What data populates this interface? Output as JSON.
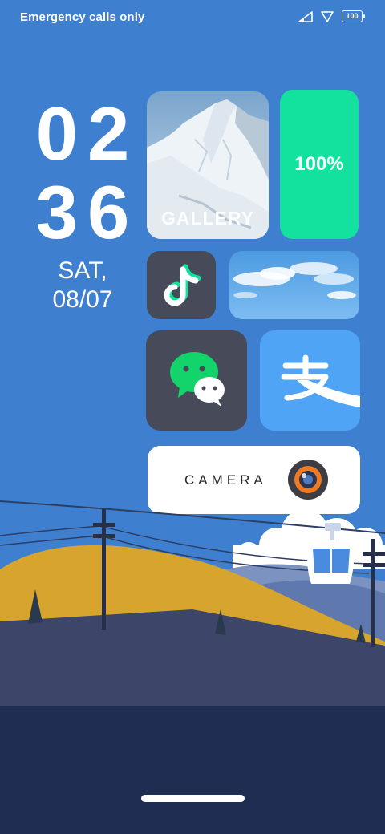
{
  "status_bar": {
    "carrier_text": "Emergency calls only",
    "battery_level": "100"
  },
  "clock": {
    "hours": "02",
    "minutes": "36",
    "day": "SAT,",
    "date": "08/07"
  },
  "widgets": {
    "gallery_label": "GALLERY",
    "battery_percent": "100%",
    "camera_label": "CAMERA",
    "tiktok_icon": "tiktok-icon",
    "wechat_icon": "wechat-icon",
    "alipay_icon": "alipay-icon"
  },
  "colors": {
    "background": "#3e80cf",
    "battery_widget": "#13e29e",
    "dark_tile": "#474a59",
    "alipay_tile": "#4fa4f6"
  }
}
